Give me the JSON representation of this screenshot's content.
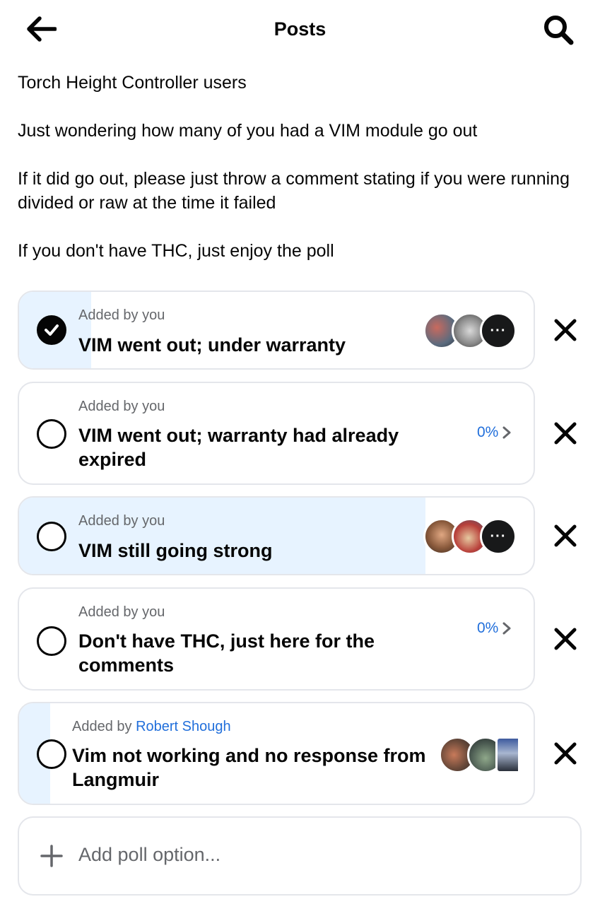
{
  "header": {
    "title": "Posts",
    "back_icon": "arrow-left-icon",
    "search_icon": "search-icon"
  },
  "post": {
    "paragraphs": [
      "Torch Height Controller users",
      "Just wondering how many of you had a VIM module go out",
      "If it did go out, please just throw a comment stating if you were running divided or raw at the time it failed",
      "If you don't have THC, just enjoy the poll"
    ]
  },
  "poll": {
    "options": [
      {
        "added_prefix": "Added by ",
        "added_by": "you",
        "label": "VIM went out; under warranty",
        "selected": true,
        "share": 0.14,
        "percent": "",
        "voters_shown": 3
      },
      {
        "added_prefix": "Added by ",
        "added_by": "you",
        "label": "VIM went out; warranty had already expired",
        "selected": false,
        "share": 0,
        "percent": "0%",
        "voters_shown": 0
      },
      {
        "added_prefix": "Added by ",
        "added_by": "you",
        "label": "VIM still going strong",
        "selected": false,
        "share": 0.79,
        "percent": "",
        "voters_shown": 3
      },
      {
        "added_prefix": "Added by ",
        "added_by": "you",
        "label": "Don't have THC, just here for the comments",
        "selected": false,
        "share": 0,
        "percent": "0%",
        "voters_shown": 0
      },
      {
        "added_prefix": "Added by ",
        "added_by": "Robert Shough",
        "label": "Vim not working and no response from Langmuir",
        "selected": false,
        "share": 0.06,
        "percent": "",
        "voters_shown": 3
      }
    ],
    "add_option_label": "Add poll option...",
    "more_voters_glyph": "···"
  },
  "colors": {
    "fill": "#e7f3ff",
    "link": "#216fdb",
    "border": "#e4e6eb",
    "muted_text": "#65676b"
  }
}
